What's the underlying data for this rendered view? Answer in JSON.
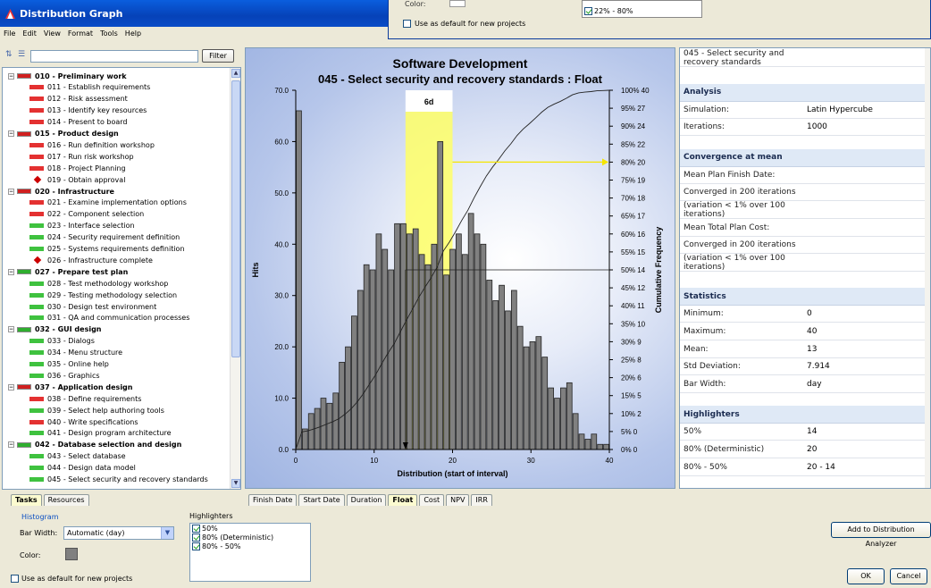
{
  "window": {
    "title": "Distribution Graph"
  },
  "overlay": {
    "color_label": "Color:",
    "highlighter_partial": "22% - 80%",
    "default_label": "Use as default for new projects"
  },
  "menu": [
    "File",
    "Edit",
    "View",
    "Format",
    "Tools",
    "Help"
  ],
  "toolbar": {
    "filter_label": "Filter",
    "filter_value": ""
  },
  "tree": [
    {
      "label": "010 - Preliminary work",
      "kind": "group",
      "color": "red"
    },
    {
      "label": "011 - Establish requirements",
      "kind": "task",
      "color": "red"
    },
    {
      "label": "012 - Risk assessment",
      "kind": "task",
      "color": "red"
    },
    {
      "label": "013 - Identify key resources",
      "kind": "task",
      "color": "red"
    },
    {
      "label": "014 - Present to board",
      "kind": "task",
      "color": "red"
    },
    {
      "label": "015 - Product design",
      "kind": "group",
      "color": "red"
    },
    {
      "label": "016 - Run definition workshop",
      "kind": "task",
      "color": "red"
    },
    {
      "label": "017 - Run risk workshop",
      "kind": "task",
      "color": "red"
    },
    {
      "label": "018 - Project Planning",
      "kind": "task",
      "color": "red"
    },
    {
      "label": "019 - Obtain approval",
      "kind": "milestone",
      "color": "red"
    },
    {
      "label": "020 - Infrastructure",
      "kind": "group",
      "color": "red"
    },
    {
      "label": "021 - Examine implementation options",
      "kind": "task",
      "color": "red"
    },
    {
      "label": "022 - Component selection",
      "kind": "task",
      "color": "red"
    },
    {
      "label": "023 - Interface selection",
      "kind": "task",
      "color": "green"
    },
    {
      "label": "024 - Security requirement definition",
      "kind": "task",
      "color": "green"
    },
    {
      "label": "025 - Systems requirements definition",
      "kind": "task",
      "color": "green"
    },
    {
      "label": "026 - Infrastructure complete",
      "kind": "milestone",
      "color": "red"
    },
    {
      "label": "027 - Prepare test plan",
      "kind": "group",
      "color": "green"
    },
    {
      "label": "028 - Test methodology workshop",
      "kind": "task",
      "color": "green"
    },
    {
      "label": "029 - Testing methodology selection",
      "kind": "task",
      "color": "green"
    },
    {
      "label": "030 - Design test environment",
      "kind": "task",
      "color": "green"
    },
    {
      "label": "031 - QA and communication processes",
      "kind": "task",
      "color": "green"
    },
    {
      "label": "032 - GUI design",
      "kind": "group",
      "color": "green"
    },
    {
      "label": "033 - Dialogs",
      "kind": "task",
      "color": "green"
    },
    {
      "label": "034 - Menu structure",
      "kind": "task",
      "color": "green"
    },
    {
      "label": "035 - Online help",
      "kind": "task",
      "color": "green"
    },
    {
      "label": "036 - Graphics",
      "kind": "task",
      "color": "green"
    },
    {
      "label": "037 - Application design",
      "kind": "group",
      "color": "red"
    },
    {
      "label": "038 - Define requirements",
      "kind": "task",
      "color": "red"
    },
    {
      "label": "039 - Select help authoring tools",
      "kind": "task",
      "color": "green"
    },
    {
      "label": "040 - Write specifications",
      "kind": "task",
      "color": "red"
    },
    {
      "label": "041 - Design program architecture",
      "kind": "task",
      "color": "green"
    },
    {
      "label": "042 - Database selection and design",
      "kind": "group",
      "color": "green"
    },
    {
      "label": "043 - Select database",
      "kind": "task",
      "color": "green"
    },
    {
      "label": "044 - Design data model",
      "kind": "task",
      "color": "green"
    },
    {
      "label": "045 - Select security and recovery standards",
      "kind": "task",
      "color": "green"
    }
  ],
  "left_tabs": [
    "Tasks",
    "Resources"
  ],
  "center_tabs": [
    "Finish Date",
    "Start Date",
    "Duration",
    "Float",
    "Cost",
    "NPV",
    "IRR"
  ],
  "active_center_tab": "Float",
  "chart_data": {
    "type": "bar",
    "title": "Software Development",
    "subtitle": "045 - Select security and recovery standards : Float",
    "xlabel": "Distribution (start of interval)",
    "ylabel": "Hits",
    "y2label": "Cumulative Frequency",
    "xlim": [
      0,
      40
    ],
    "ylim": [
      0,
      70
    ],
    "x_ticks": [
      "0",
      "10",
      "20",
      "30",
      "40"
    ],
    "y_ticks": [
      "0.0",
      "10.0",
      "20.0",
      "30.0",
      "40.0",
      "50.0",
      "60.0",
      "70.0"
    ],
    "y2_ticks": [
      "0% 0",
      "5% 0",
      "10% 2",
      "15% 5",
      "20% 6",
      "25% 8",
      "30% 9",
      "35% 10",
      "40% 11",
      "45% 12",
      "50% 14",
      "55% 15",
      "60% 16",
      "65% 17",
      "70% 18",
      "75% 19",
      "80% 20",
      "85% 22",
      "90% 24",
      "95% 27",
      "100% 40"
    ],
    "values": [
      66,
      4,
      7,
      8,
      10,
      9,
      11,
      17,
      20,
      26,
      31,
      36,
      35,
      42,
      39,
      35,
      44,
      44,
      42,
      43,
      38,
      36,
      40,
      60,
      34,
      39,
      42,
      38,
      46,
      42,
      40,
      33,
      29,
      32,
      27,
      31,
      24,
      20,
      21,
      22,
      18,
      12,
      10,
      12,
      13,
      7,
      3,
      2,
      3,
      1,
      1
    ],
    "highlight_label": "6d",
    "highlight_range": [
      14,
      20
    ],
    "markers": {
      "p50": 14,
      "p80": 20
    },
    "grid": false
  },
  "right_pane": {
    "header": "045 - Select security and recovery standards",
    "analysis": {
      "title": "Analysis",
      "rows": [
        [
          "Simulation:",
          "Latin Hypercube"
        ],
        [
          "Iterations:",
          "1000"
        ]
      ]
    },
    "convergence": {
      "title": "Convergence at mean",
      "rows": [
        "Mean Plan Finish Date:",
        "Converged in 200 iterations",
        "(variation < 1% over 100 iterations)",
        "Mean Total Plan Cost:",
        "Converged in 200 iterations",
        "(variation < 1% over 100 iterations)"
      ]
    },
    "statistics": {
      "title": "Statistics",
      "rows": [
        [
          "Minimum:",
          "0"
        ],
        [
          "Maximum:",
          "40"
        ],
        [
          "Mean:",
          "13"
        ],
        [
          "Std Deviation:",
          "7.914"
        ],
        [
          "Bar Width:",
          "day"
        ]
      ]
    },
    "highlighters": {
      "title": "Highlighters",
      "rows": [
        [
          "50%",
          "14"
        ],
        [
          "80% (Deterministic)",
          "20"
        ],
        [
          "80% - 50%",
          "20 - 14"
        ]
      ]
    }
  },
  "bottom": {
    "histogram_label": "Histogram",
    "bar_width_label": "Bar Width:",
    "bar_width_value": "Automatic (day)",
    "color_label": "Color:",
    "default_label": "Use as default for new projects",
    "highlighters_label": "Highlighters",
    "highlighters": [
      {
        "label": "50%",
        "checked": true
      },
      {
        "label": "80% (Deterministic)",
        "checked": true
      },
      {
        "label": "80% - 50%",
        "checked": true
      }
    ],
    "add_button": "Add to Distribution Analyzer",
    "ok_button": "OK",
    "cancel_button": "Cancel"
  }
}
